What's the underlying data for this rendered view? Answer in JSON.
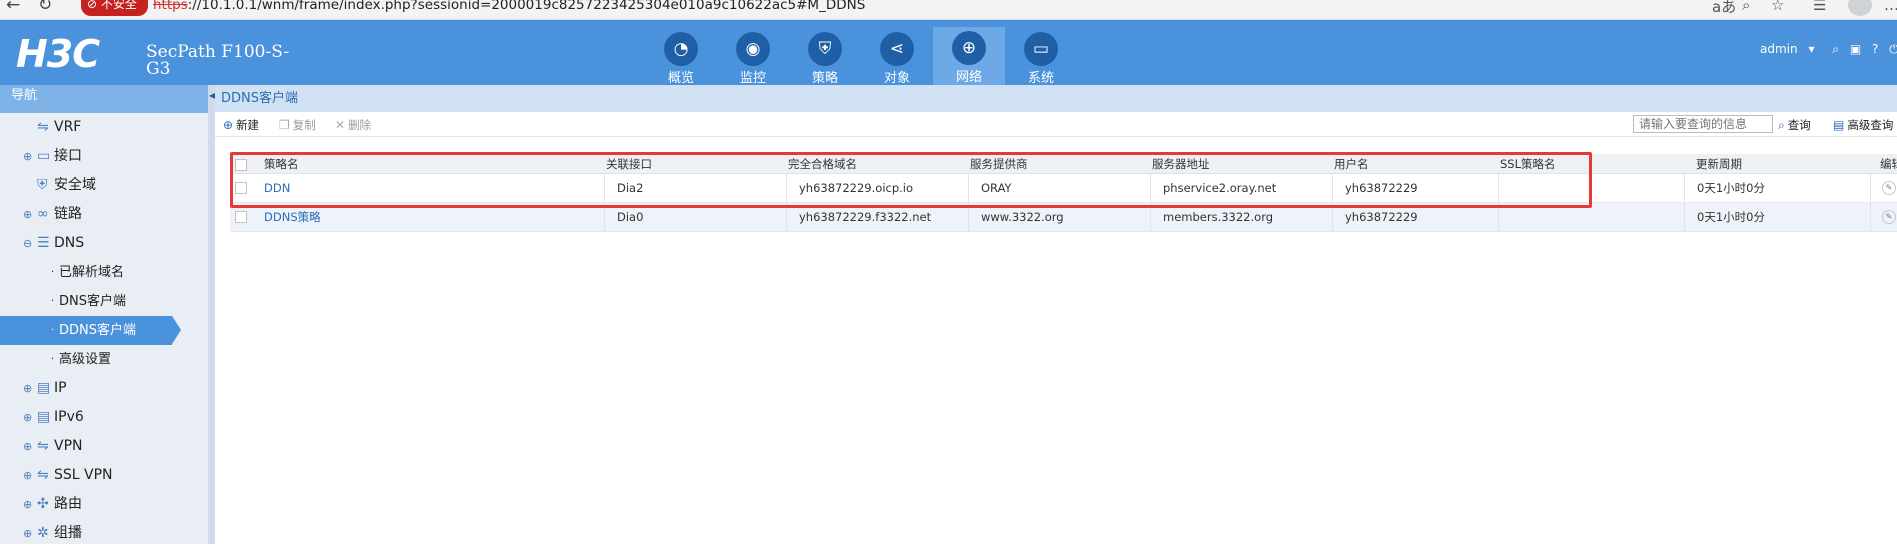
{
  "browser": {
    "insecure_label": "不安全",
    "url_scheme": "https",
    "url_rest": "://10.1.0.1/wnm/frame/index.php?sessionid=2000019c8257223425304e010a9c10622ac5#M_DDNS"
  },
  "header": {
    "logo": "H3C",
    "product_line1": "SecPath F100-S-",
    "product_line2": "G3",
    "modules": [
      {
        "label": "概览",
        "icon": "gauge-icon"
      },
      {
        "label": "监控",
        "icon": "monitor-icon"
      },
      {
        "label": "策略",
        "icon": "shield-icon"
      },
      {
        "label": "对象",
        "icon": "share-icon"
      },
      {
        "label": "网络",
        "icon": "globe-icon"
      },
      {
        "label": "系统",
        "icon": "screen-icon"
      }
    ],
    "active_module": "网络",
    "user": "admin"
  },
  "leftnav": {
    "title": "导航",
    "items": [
      {
        "label": "VRF",
        "type": "leaf"
      },
      {
        "label": "接口",
        "type": "group"
      },
      {
        "label": "安全域",
        "type": "leaf"
      },
      {
        "label": "链路",
        "type": "group"
      },
      {
        "label": "DNS",
        "type": "group-open"
      },
      {
        "label": "已解析域名",
        "type": "sub"
      },
      {
        "label": "DNS客户端",
        "type": "sub"
      },
      {
        "label": "DDNS客户端",
        "type": "sub-active"
      },
      {
        "label": "高级设置",
        "type": "sub"
      },
      {
        "label": "IP",
        "type": "group"
      },
      {
        "label": "IPv6",
        "type": "group"
      },
      {
        "label": "VPN",
        "type": "group"
      },
      {
        "label": "SSL VPN",
        "type": "group"
      },
      {
        "label": "路由",
        "type": "group"
      },
      {
        "label": "组播",
        "type": "group"
      }
    ]
  },
  "main": {
    "breadcrumb": "DDNS客户端",
    "toolbar": {
      "new_label": "新建",
      "copy_label": "复制",
      "delete_label": "删除",
      "search_placeholder": "请输入要查询的信息",
      "query_label": "查询",
      "advanced_label": "高级查询"
    },
    "table": {
      "columns": [
        "策略名",
        "关联接口",
        "完全合格域名",
        "服务提供商",
        "服务器地址",
        "用户名",
        "SSL策略名",
        "更新周期",
        "编辑"
      ],
      "rows": [
        {
          "name": "DDN",
          "interface": "Dia2",
          "fqdn": "yh63872229.oicp.io",
          "provider": "ORAY",
          "server": "phservice2.oray.net",
          "user": "yh63872229",
          "ssl": "",
          "period": "0天1小时0分"
        },
        {
          "name": "DDNS策略",
          "interface": "Dia0",
          "fqdn": "yh63872229.f3322.net",
          "provider": "www.3322.org",
          "server": "members.3322.org",
          "user": "yh63872229",
          "ssl": "",
          "period": "0天1小时0分"
        }
      ]
    }
  },
  "colors": {
    "header_bg": "#4b92dc",
    "active_module_bg": "#6da9e6",
    "highlight_border": "#e53935",
    "link": "#2b6cb5"
  }
}
